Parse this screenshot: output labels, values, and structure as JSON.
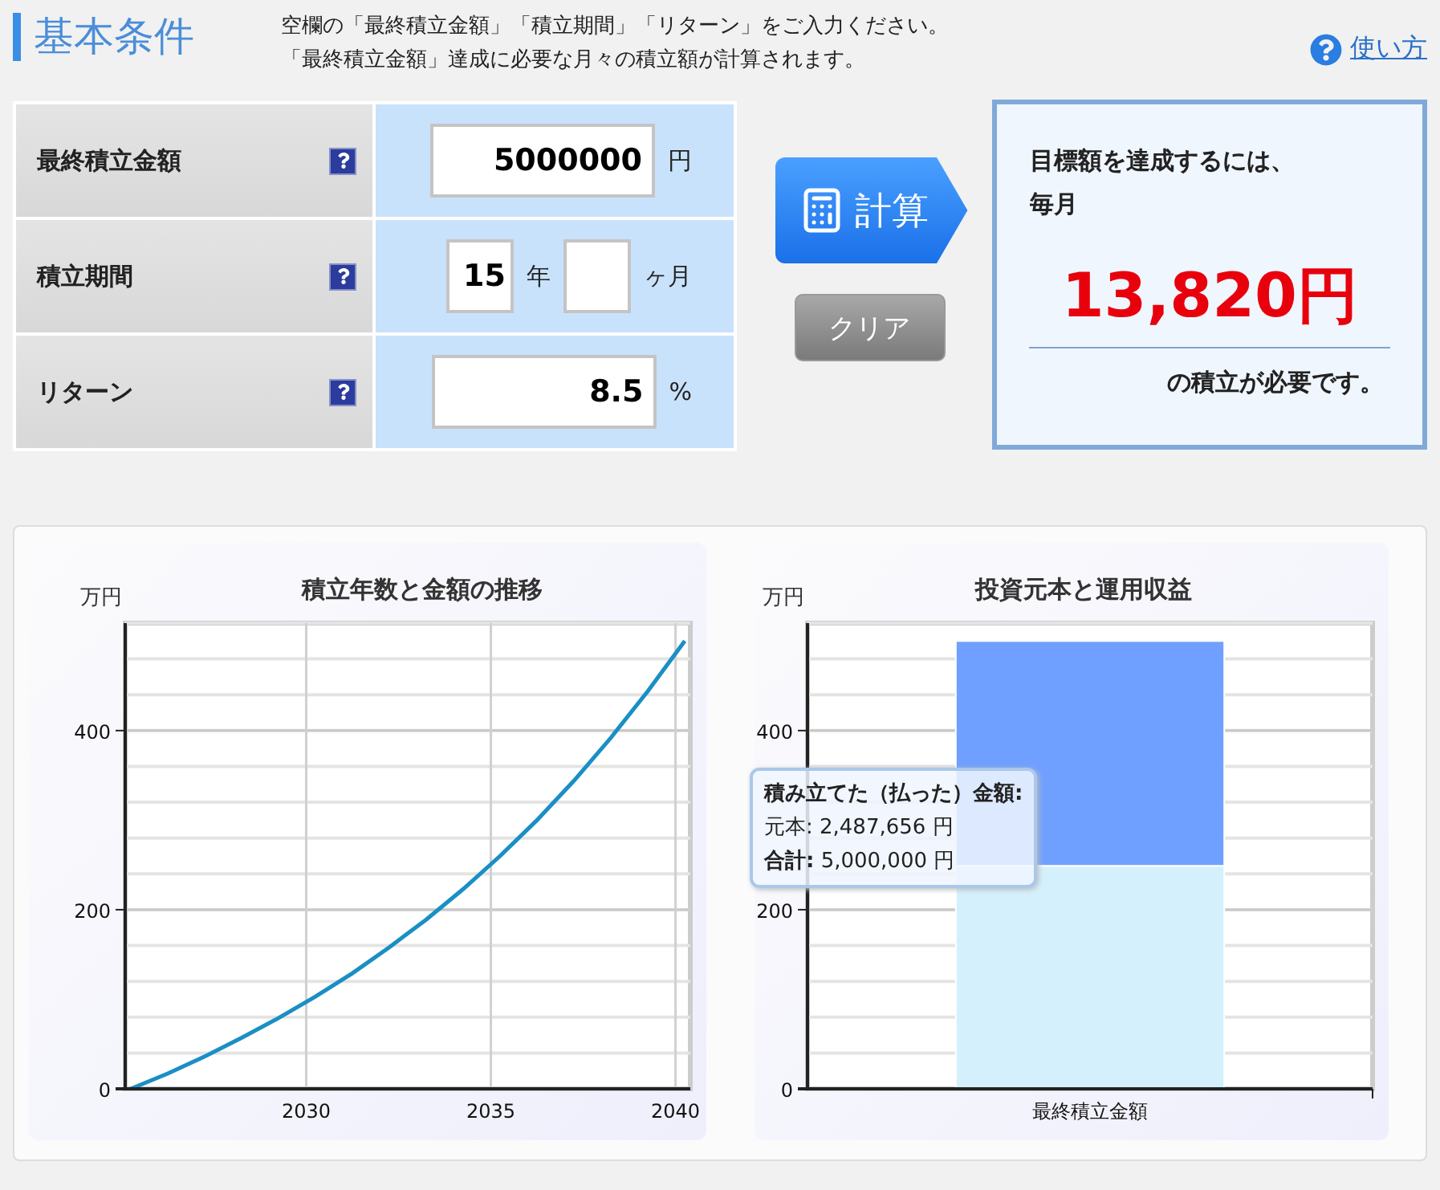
{
  "header": {
    "title": "基本条件",
    "description": [
      "空欄の「最終積立金額」「積立期間」「リターン」をご入力ください。",
      "「最終積立金額」達成に必要な月々の積立額が計算されます。"
    ],
    "help_link": "使い方"
  },
  "form": {
    "rows": [
      {
        "label": "最終積立金額",
        "fields": [
          {
            "value": "5000000",
            "unit": "円"
          }
        ]
      },
      {
        "label": "積立期間",
        "fields": [
          {
            "value": "15",
            "unit": "年"
          },
          {
            "unit": "ヶ月"
          }
        ]
      },
      {
        "label": "リターン",
        "fields": [
          {
            "value": "8.5",
            "unit": "%"
          }
        ]
      }
    ]
  },
  "buttons": {
    "calculate": "計算",
    "clear": "クリア"
  },
  "result": {
    "lead": "目標額を達成するには、",
    "period": "毎月",
    "amount": "13,820円",
    "tail": "の積立が必要です。"
  },
  "charts": [
    {
      "chart_data": {
        "type": "line",
        "title": "積立年数と金額の推移",
        "ylabel": "万円",
        "grid": true,
        "x": [
          2025.25,
          2026.25,
          2027.25,
          2028.25,
          2029.25,
          2030.25,
          2031.25,
          2032.25,
          2033.25,
          2034.25,
          2035.25,
          2036.25,
          2037.25,
          2038.25,
          2039.25,
          2040.25
        ],
        "xlim": [
          2025.1,
          2040.4
        ],
        "ylim": [
          0,
          520
        ],
        "xticks": [
          2030,
          2035,
          2040
        ],
        "yticks": [
          0,
          200,
          400
        ],
        "series": [
          {
            "color": "#1a8fc4",
            "values": [
              0,
              17,
              36,
              57,
              79,
              103,
              129,
              158,
              189,
              223,
              260,
              300,
              344,
              392,
              444,
              500
            ]
          }
        ]
      }
    },
    {
      "chart_data": {
        "type": "bar",
        "title": "投資元本と運用収益",
        "ylabel": "万円",
        "grid": true,
        "categories": [
          "最終積立金額"
        ],
        "stacked": true,
        "ylim": [
          0,
          520
        ],
        "yticks": [
          0,
          200,
          400
        ],
        "series": [
          {
            "color": "#d4f0fc",
            "values": [
              249
            ]
          },
          {
            "color": "#70a0ff",
            "values": [
              251
            ]
          }
        ]
      },
      "tooltip": [
        "積み立てた（払った）金額:",
        "元本: 2,487,656 円",
        "**合計:**  5,000,000 円"
      ]
    }
  ]
}
